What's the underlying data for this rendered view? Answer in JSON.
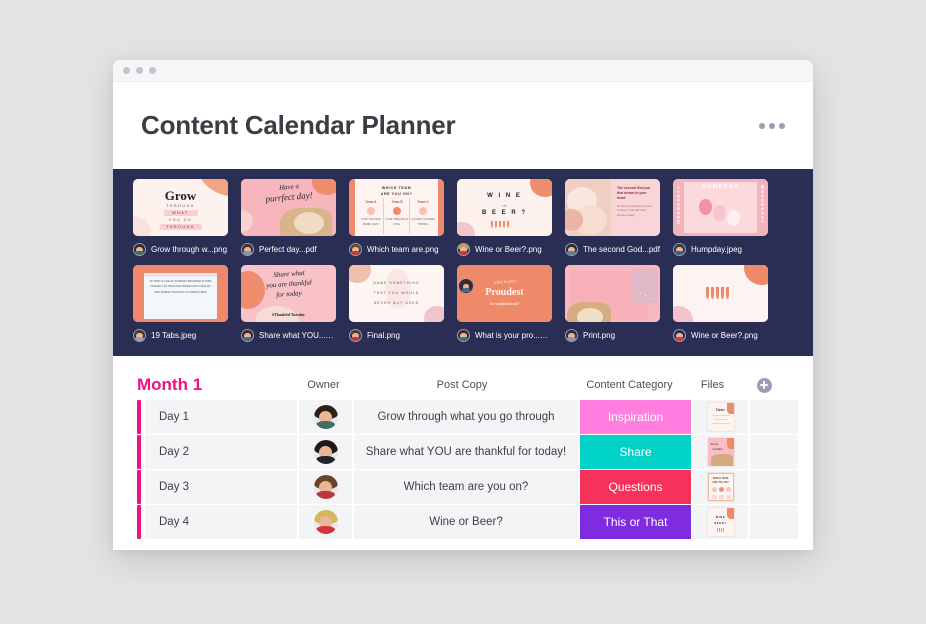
{
  "window": {
    "traffic_lights": 3,
    "title": "Content Calendar Planner",
    "menu_icon": "kebab-menu-icon"
  },
  "colors": {
    "page_background": "#e4e4e4",
    "gallery_background": "#2b2e54",
    "month_accent": "#f5107f",
    "row_accent": "#ee1382",
    "badge_inspiration": "#ff7ee0",
    "badge_share": "#00d2c7",
    "badge_questions": "#f5325b",
    "badge_thisorthat": "#7f2be0"
  },
  "gallery": {
    "rows": [
      [
        {
          "file_name": "Grow through w...png",
          "type": "png",
          "avatar": "avatar-1"
        },
        {
          "file_name": "Perfect day...pdf",
          "type": "pdf",
          "avatar": "avatar-2"
        },
        {
          "file_name": "Which team are.png",
          "type": "png",
          "avatar": "avatar-3"
        },
        {
          "file_name": "Wine or Beer?.png",
          "type": "png",
          "avatar": "avatar-4"
        },
        {
          "file_name": "The second God...pdf",
          "type": "pdf",
          "avatar": "avatar-5"
        },
        {
          "file_name": "Humpday.jpeg",
          "type": "jpeg",
          "avatar": "avatar-6"
        }
      ],
      [
        {
          "file_name": "19 Tabs.jpeg",
          "type": "jpeg",
          "avatar": "avatar-7"
        },
        {
          "file_name": "Share what YOU...png",
          "type": "png",
          "avatar": "avatar-8"
        },
        {
          "file_name": "Final.png",
          "type": "png",
          "avatar": "avatar-9"
        },
        {
          "file_name": "What is your pro...png",
          "type": "png",
          "avatar": "avatar-10"
        },
        {
          "file_name": "Print.png",
          "type": "png",
          "avatar": "avatar-11"
        },
        {
          "file_name": "Wine or Beer?.png",
          "type": "png",
          "avatar": "avatar-12"
        }
      ]
    ],
    "artwork_text": {
      "grow_title": "Grow",
      "grow_l1": "THROUGH",
      "grow_l2": "WHAT",
      "grow_l3": "YOU  GO",
      "grow_l4": "THROUGH",
      "purrfect_l1": "Have a",
      "purrfect_l2": "purrfect day!",
      "team_l1": "WHICH TEAM",
      "team_l2": "ARE YOU ON?",
      "team_a": "Team A",
      "team_b": "Team B",
      "team_c": "Team C",
      "wine_l1": "W I N E",
      "wine_l2": "or",
      "wine_l3": "B E E R ?",
      "second_god": "The second God put that dream in your heart.",
      "humpday": "HUMPDAY",
      "wednesday": "WEDNESDAY",
      "tabs_text": "MY MIND IS LIKE MY INTERNET BROWSER 19 TABS OPENED 3 OF THEM ARE FROZEN AND I HAVE NO IDEA WHERE THE MUSIC IS COMING FROM",
      "thankful_l1": "Share what",
      "thankful_l2": "you are thankful",
      "thankful_l3": "for today",
      "thankful_tag": "#Thankful Tuesday",
      "final_l1": "NAME SOMETHING",
      "final_l2": "THAT YOU WOULD",
      "final_l3": "NEVER BUY USED",
      "proudest_l1": "what is your",
      "proudest_l2": "Proudest",
      "proudest_l3": "Accomplishment?"
    }
  },
  "table": {
    "month_label": "Month 1",
    "columns": [
      "Owner",
      "Post Copy",
      "Content Category",
      "Files"
    ],
    "add_column_icon": "plus-circle-icon",
    "rows": [
      {
        "day": "Day 1",
        "owner_avatar": "avatar-row-1",
        "post_copy": "Grow through what you go through",
        "category": "Inspiration",
        "category_color": "#ff7ee0",
        "file_thumb": "grow-thumb"
      },
      {
        "day": "Day 2",
        "owner_avatar": "avatar-row-2",
        "post_copy": "Share what YOU are thankful for today!",
        "category": "Share",
        "category_color": "#00d2c7",
        "file_thumb": "purrfect-thumb"
      },
      {
        "day": "Day 3",
        "owner_avatar": "avatar-row-3",
        "post_copy": "Which team are you on?",
        "category": "Questions",
        "category_color": "#f5325b",
        "file_thumb": "team-thumb"
      },
      {
        "day": "Day 4",
        "owner_avatar": "avatar-row-4",
        "post_copy": "Wine or Beer?",
        "category": "This or That",
        "category_color": "#7f2be0",
        "file_thumb": "wine-thumb"
      }
    ]
  }
}
